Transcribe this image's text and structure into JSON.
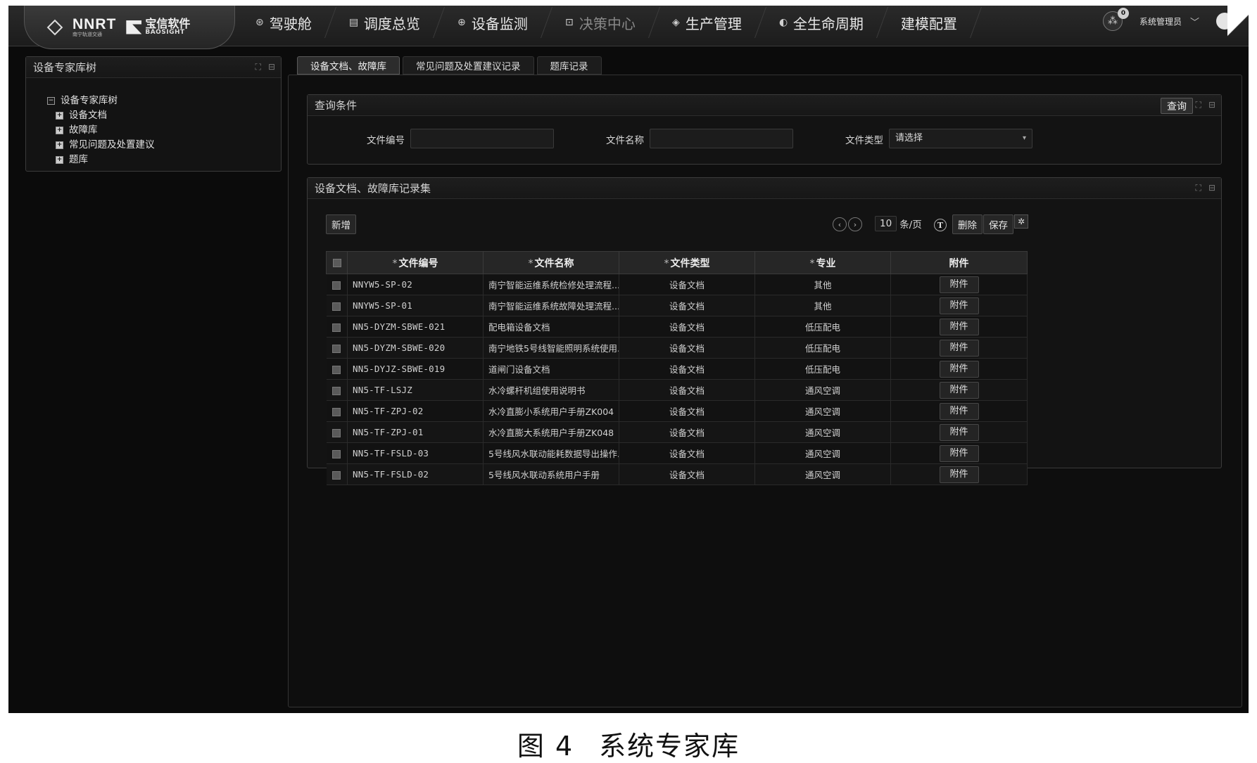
{
  "logo": {
    "nnrt_main": "NNRT",
    "nnrt_sub": "南宁轨道交通",
    "baosight_cn": "宝信软件",
    "baosight_en": "BAOSIGHT"
  },
  "nav": {
    "items": [
      {
        "label": "驾驶舱",
        "icon": "⊛"
      },
      {
        "label": "调度总览",
        "icon": "▤"
      },
      {
        "label": "设备监测",
        "icon": "⊕"
      },
      {
        "label": "决策中心",
        "icon": "⊡"
      },
      {
        "label": "生产管理",
        "icon": "◈"
      },
      {
        "label": "全生命周期",
        "icon": "◐"
      },
      {
        "label": "建模配置",
        "icon": ""
      }
    ]
  },
  "user": {
    "badge_count": "0",
    "name": "系统管理员"
  },
  "tree": {
    "title": "设备专家库树",
    "root": "设备专家库树",
    "children": [
      "设备文档",
      "故障库",
      "常见问题及处置建议",
      "题库"
    ]
  },
  "tabs": [
    {
      "label": "设备文档、故障库"
    },
    {
      "label": "常见问题及处置建议记录"
    },
    {
      "label": "题库记录"
    }
  ],
  "query": {
    "title": "查询条件",
    "button": "查询",
    "fields": {
      "doc_no_label": "文件编号",
      "doc_no_value": "",
      "doc_name_label": "文件名称",
      "doc_name_value": "",
      "doc_type_label": "文件类型",
      "doc_type_value": "请选择"
    }
  },
  "records": {
    "title": "设备文档、故障库记录集",
    "add_button": "新增",
    "page_size": "10",
    "page_unit": "条/页",
    "delete_button": "删除",
    "save_button": "保存",
    "columns": [
      "文件编号",
      "文件名称",
      "文件类型",
      "专业",
      "附件"
    ],
    "attach_label": "附件",
    "rows": [
      {
        "no": "NNYW5-SP-02",
        "name": "南宁智能运维系统检修处理流程...",
        "type": "设备文档",
        "major": "其他"
      },
      {
        "no": "NNYW5-SP-01",
        "name": "南宁智能运维系统故障处理流程...",
        "type": "设备文档",
        "major": "其他"
      },
      {
        "no": "NN5-DYZM-SBWE-021",
        "name": "配电箱设备文档",
        "type": "设备文档",
        "major": "低压配电"
      },
      {
        "no": "NN5-DYZM-SBWE-020",
        "name": "南宁地铁5号线智能照明系统使用...",
        "type": "设备文档",
        "major": "低压配电"
      },
      {
        "no": "NN5-DYJZ-SBWE-019",
        "name": "道闸门设备文档",
        "type": "设备文档",
        "major": "低压配电"
      },
      {
        "no": "NN5-TF-LSJZ",
        "name": "水冷螺杆机组使用说明书",
        "type": "设备文档",
        "major": "通风空调"
      },
      {
        "no": "NN5-TF-ZPJ-02",
        "name": "水冷直膨小系统用户手册ZK004",
        "type": "设备文档",
        "major": "通风空调"
      },
      {
        "no": "NN5-TF-ZPJ-01",
        "name": "水冷直膨大系统用户手册ZK048",
        "type": "设备文档",
        "major": "通风空调"
      },
      {
        "no": "NN5-TF-FSLD-03",
        "name": "5号线风水联动能耗数据导出操作...",
        "type": "设备文档",
        "major": "通风空调"
      },
      {
        "no": "NN5-TF-FSLD-02",
        "name": "5号线风水联动系统用户手册",
        "type": "设备文档",
        "major": "通风空调"
      }
    ]
  },
  "caption": {
    "fig": "图 4",
    "text": "系统专家库"
  }
}
